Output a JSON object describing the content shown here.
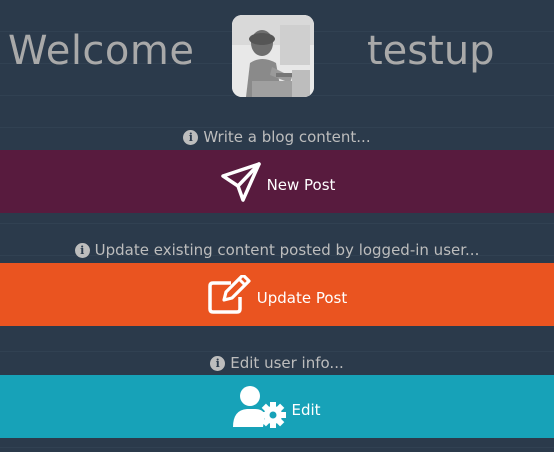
{
  "header": {
    "welcome": "Welcome",
    "username": "testup"
  },
  "new_post": {
    "hint": "Write a blog content...",
    "label": "New Post",
    "icon": "paper-plane-icon",
    "color": "#581b3e"
  },
  "update_post": {
    "hint": "Update existing content posted by logged-in user...",
    "label": "Update Post",
    "icon": "edit-icon",
    "color": "#ea5420"
  },
  "edit_user": {
    "hint": "Edit user info...",
    "label": "Edit",
    "icon": "user-cog-icon",
    "color": "#17a2b8"
  },
  "colors": {
    "background": "#2b3a4b",
    "muted_text": "#a9a9a9"
  }
}
